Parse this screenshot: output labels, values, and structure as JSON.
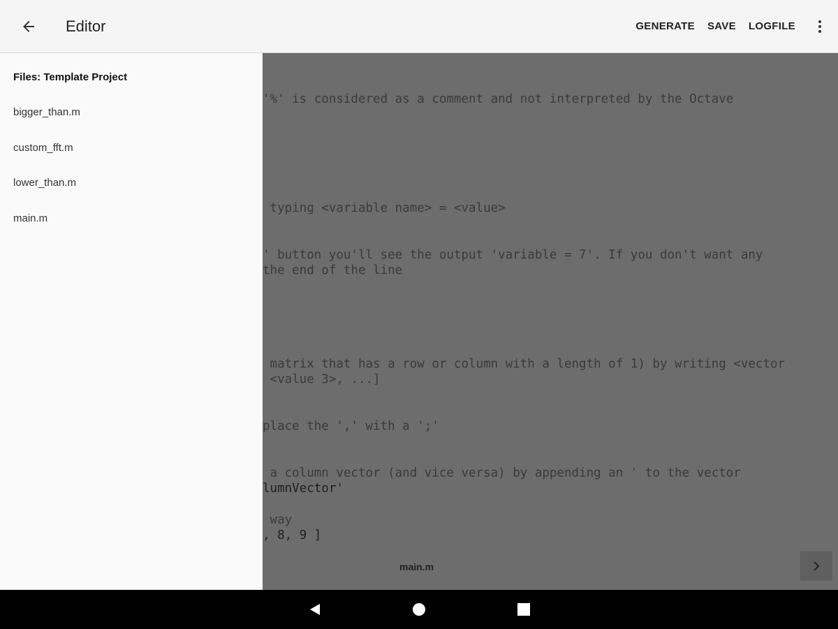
{
  "toolbar": {
    "title": "Editor",
    "actions": {
      "generate": "GENERATE",
      "save": "SAVE",
      "logfile": "LOGFILE"
    },
    "icons": [
      "back-arrow-icon",
      "more-vert-icon"
    ]
  },
  "drawer": {
    "header": "Files: Template Project",
    "files": [
      "bigger_than.m",
      "custom_fft.m",
      "lower_than.m",
      "main.m"
    ]
  },
  "editor": {
    "lines": [
      "'%' is considered as a comment and not interpreted by the Octave",
      " typing <variable name> = <value>",
      "' button you'll see the output 'variable = 7'. If you don't want any",
      "the end of the line",
      " matrix that has a row or column with a length of 1) by writing <vector",
      " <value 3>, ...]",
      "place the ',' with a ';'",
      " a column vector (and vice versa) by appending an ' to the vector",
      "lumnVector'",
      " way",
      ", 8, 9 ]"
    ],
    "current_file": "main.m",
    "next_icon": "chevron-right-icon"
  },
  "navbar": {
    "icons": [
      "back-triangle-icon",
      "home-circle-icon",
      "recents-square-icon"
    ]
  },
  "colors": {
    "toolbar_bg": "#f5f5f5",
    "drawer_bg": "#fafafa",
    "scrim_editor": "#6d6d6d",
    "navbar_bg": "#000000"
  }
}
